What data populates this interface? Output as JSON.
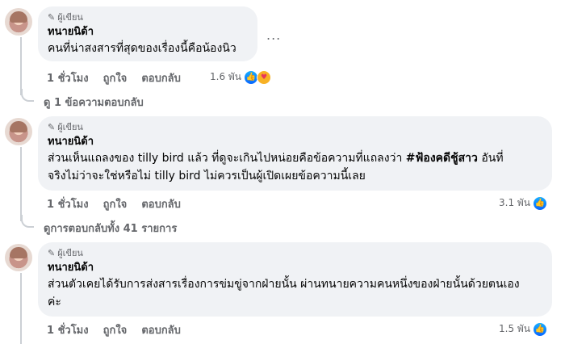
{
  "comments": [
    {
      "badge": "ผู้เขียน",
      "author": "ทนายนิด้า",
      "text": "คนที่น่าสงสารที่สุดของเรื่องนี้คือน้องนิว",
      "time": "1 ชั่วโมง",
      "like_label": "ถูกใจ",
      "reply_label": "ตอบกลับ",
      "reactions": "1.6 พัน",
      "replies_link": "ดู 1 ข้อความตอบกลับ"
    },
    {
      "badge": "ผู้เขียน",
      "author": "ทนายนิด้า",
      "text_parts": [
        "ส่วนเห็นแถลงของ tilly bird แล้ว ที่ดูจะเกินไปหน่อยคือข้อความที่แถลงว่า ",
        "#ฟ้องคดีชู้สาว",
        " อันที่",
        "จริงไม่ว่าจะใช่หรือไม่ tilly bird ไม่ควรเป็นผู้เปิดเผยข้อความนี้เลย"
      ],
      "time": "1 ชั่วโมง",
      "like_label": "ถูกใจ",
      "reply_label": "ตอบกลับ",
      "reactions": "3.1 พัน",
      "replies_link": "ดูการตอบกลับทั้ง 41 รายการ"
    },
    {
      "badge": "ผู้เขียน",
      "author": "ทนายนิด้า",
      "text_lines": [
        "ส่วนตัวเคยได้รับการส่งสารเรื่องการข่มขู่จากฝ่ายนั้น ผ่านทนายความคนหนึ่งของฝ่ายนั้นด้วยตนเอง",
        "ค่ะ"
      ],
      "time": "1 ชั่วโมง",
      "like_label": "ถูกใจ",
      "reply_label": "ตอบกลับ",
      "reactions": "1.5 พัน"
    }
  ],
  "more_label": "...",
  "icons": {
    "badge": "pencil-icon",
    "like": "like-reaction-icon",
    "care": "care-reaction-icon"
  },
  "colors": {
    "bubble": "#f0f2f5",
    "meta": "#65676b",
    "like": "#0866ff"
  }
}
